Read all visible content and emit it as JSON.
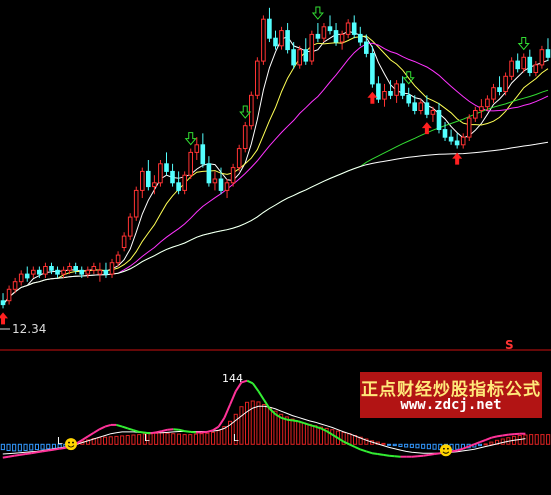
{
  "watermark": {
    "title": "正点财经炒股指标公式",
    "url": "www.zdcj.net"
  },
  "colors": {
    "background": "#000000",
    "up_candle": "#ff3333",
    "down_candle": "#54ffff",
    "ma5": "#ffffff",
    "ma10": "#ffff55",
    "ma20": "#ff33ff",
    "ma60": "#33dd33",
    "ma120": "#ffffff",
    "buy_arrow": "#ff2020",
    "sell_arrow": "#33dd33",
    "separator": "#cc1111",
    "osc_up_line": "#ff3399",
    "osc_down_line": "#33ee33",
    "osc_signal": "#ffffff",
    "osc_bar_up": "#dd2222",
    "osc_bar_down": "#3399ff",
    "smiley": "#ffd400"
  },
  "chart_data": [
    {
      "type": "candlestick",
      "annotations": {
        "low_price_label": "12.34",
        "marker_s": "S"
      },
      "candles": [
        [
          11.9,
          12.1,
          11.7,
          11.8
        ],
        [
          11.9,
          12.3,
          11.8,
          12.2
        ],
        [
          12.2,
          12.5,
          12.1,
          12.4
        ],
        [
          12.4,
          12.7,
          12.3,
          12.6
        ],
        [
          12.6,
          12.8,
          12.4,
          12.5
        ],
        [
          12.6,
          12.8,
          12.5,
          12.7
        ],
        [
          12.7,
          12.8,
          12.5,
          12.6
        ],
        [
          12.6,
          12.9,
          12.5,
          12.8
        ],
        [
          12.8,
          12.9,
          12.6,
          12.7
        ],
        [
          12.7,
          12.8,
          12.5,
          12.6
        ],
        [
          12.6,
          12.8,
          12.5,
          12.7
        ],
        [
          12.7,
          12.9,
          12.6,
          12.8
        ],
        [
          12.8,
          12.9,
          12.6,
          12.7
        ],
        [
          12.7,
          12.8,
          12.5,
          12.6
        ],
        [
          12.6,
          12.8,
          12.5,
          12.7
        ],
        [
          12.7,
          12.9,
          12.6,
          12.8
        ],
        [
          12.6,
          12.9,
          12.4,
          12.7
        ],
        [
          12.7,
          12.9,
          12.5,
          12.6
        ],
        [
          12.6,
          13.0,
          12.5,
          12.9
        ],
        [
          12.9,
          13.2,
          12.8,
          13.1
        ],
        [
          13.3,
          13.7,
          13.2,
          13.6
        ],
        [
          13.6,
          14.2,
          13.5,
          14.1
        ],
        [
          14.1,
          14.9,
          14.0,
          14.8
        ],
        [
          14.8,
          15.4,
          14.6,
          15.3
        ],
        [
          15.3,
          15.6,
          14.8,
          14.9
        ],
        [
          14.9,
          15.2,
          14.7,
          15.0
        ],
        [
          15.0,
          15.6,
          14.9,
          15.5
        ],
        [
          15.5,
          15.8,
          15.2,
          15.3
        ],
        [
          15.3,
          15.5,
          14.9,
          15.0
        ],
        [
          15.0,
          15.3,
          14.7,
          14.8
        ],
        [
          14.8,
          15.3,
          14.7,
          15.2
        ],
        [
          15.2,
          15.9,
          15.1,
          15.8
        ],
        [
          15.8,
          16.2,
          15.6,
          16.0
        ],
        [
          16.0,
          16.3,
          15.4,
          15.5
        ],
        [
          15.5,
          15.7,
          14.9,
          15.0
        ],
        [
          15.0,
          15.3,
          14.8,
          15.1
        ],
        [
          15.1,
          15.4,
          14.7,
          14.8
        ],
        [
          14.8,
          15.1,
          14.6,
          15.0
        ],
        [
          15.0,
          15.5,
          14.9,
          15.4
        ],
        [
          15.4,
          16.0,
          15.3,
          15.9
        ],
        [
          15.9,
          16.6,
          15.8,
          16.5
        ],
        [
          16.5,
          17.4,
          16.4,
          17.3
        ],
        [
          17.3,
          18.3,
          17.2,
          18.2
        ],
        [
          18.2,
          19.4,
          18.1,
          19.3
        ],
        [
          19.3,
          19.6,
          18.7,
          18.8
        ],
        [
          18.8,
          19.0,
          18.5,
          18.6
        ],
        [
          18.6,
          19.1,
          18.5,
          19.0
        ],
        [
          19.0,
          19.2,
          18.4,
          18.5
        ],
        [
          18.5,
          18.7,
          18.0,
          18.1
        ],
        [
          18.1,
          18.6,
          18.0,
          18.5
        ],
        [
          18.5,
          18.8,
          18.1,
          18.2
        ],
        [
          18.2,
          19.0,
          18.1,
          18.9
        ],
        [
          18.9,
          19.2,
          18.7,
          18.8
        ],
        [
          18.8,
          19.2,
          18.7,
          19.1
        ],
        [
          19.1,
          19.4,
          18.9,
          19.0
        ],
        [
          19.0,
          19.2,
          18.6,
          18.7
        ],
        [
          18.7,
          19.0,
          18.5,
          18.9
        ],
        [
          18.9,
          19.3,
          18.8,
          19.2
        ],
        [
          19.2,
          19.4,
          18.8,
          18.9
        ],
        [
          18.9,
          19.1,
          18.6,
          18.7
        ],
        [
          18.7,
          18.9,
          18.3,
          18.4
        ],
        [
          18.4,
          18.6,
          17.5,
          17.6
        ],
        [
          17.6,
          17.8,
          17.1,
          17.2
        ],
        [
          17.2,
          17.6,
          17.0,
          17.4
        ],
        [
          17.4,
          17.7,
          17.2,
          17.3
        ],
        [
          17.3,
          17.7,
          17.1,
          17.6
        ],
        [
          17.6,
          17.8,
          17.2,
          17.3
        ],
        [
          17.3,
          17.5,
          17.0,
          17.1
        ],
        [
          17.1,
          17.3,
          16.8,
          16.9
        ],
        [
          16.9,
          17.2,
          16.8,
          17.1
        ],
        [
          17.1,
          17.3,
          16.7,
          16.8
        ],
        [
          16.8,
          17.0,
          16.6,
          16.9
        ],
        [
          16.9,
          17.1,
          16.3,
          16.4
        ],
        [
          16.4,
          16.6,
          16.1,
          16.2
        ],
        [
          16.2,
          16.4,
          16.0,
          16.1
        ],
        [
          16.1,
          16.3,
          15.9,
          16.0
        ],
        [
          16.0,
          16.3,
          15.9,
          16.2
        ],
        [
          16.2,
          16.8,
          16.1,
          16.7
        ],
        [
          16.7,
          17.0,
          16.6,
          16.9
        ],
        [
          16.9,
          17.2,
          16.7,
          17.0
        ],
        [
          17.0,
          17.3,
          16.9,
          17.2
        ],
        [
          17.2,
          17.6,
          17.1,
          17.5
        ],
        [
          17.5,
          17.8,
          17.3,
          17.4
        ],
        [
          17.4,
          17.9,
          17.3,
          17.8
        ],
        [
          17.8,
          18.3,
          17.7,
          18.2
        ],
        [
          18.2,
          18.4,
          17.9,
          18.0
        ],
        [
          18.0,
          18.4,
          17.9,
          18.3
        ],
        [
          18.3,
          18.5,
          17.8,
          17.9
        ],
        [
          17.9,
          18.2,
          17.8,
          18.1
        ],
        [
          18.1,
          18.6,
          18.0,
          18.5
        ],
        [
          18.5,
          18.8,
          18.2,
          18.3
        ]
      ],
      "buy_signals": [
        0,
        61,
        70,
        75
      ],
      "sell_signals": [
        31,
        40,
        52,
        67,
        86
      ]
    },
    {
      "type": "bar",
      "series_signal": "oscillator",
      "labels": {
        "peak_value": "144",
        "marker_1": "L",
        "marker_2": "L",
        "marker_3": "L"
      },
      "bars": [
        -12,
        -14,
        -15,
        -15,
        -14,
        -13,
        -12,
        -11,
        -10,
        -9,
        -8,
        -6,
        -2,
        3,
        7,
        10,
        13,
        15,
        16,
        17,
        18,
        19,
        20,
        21,
        22,
        23,
        24,
        25,
        26,
        25,
        24,
        23,
        22,
        22,
        23,
        24,
        25,
        27,
        31,
        40,
        52,
        68,
        85,
        95,
        98,
        96,
        90,
        83,
        75,
        68,
        62,
        57,
        52,
        48,
        45,
        42,
        39,
        36,
        33,
        30,
        27,
        24,
        20,
        16,
        12,
        8,
        5,
        2,
        -1,
        -3,
        -5,
        -6,
        -7,
        -8,
        -9,
        -10,
        -11,
        -12,
        -12,
        -12,
        -11,
        -10,
        -8,
        -6,
        -3,
        1,
        5,
        9,
        12,
        15,
        18,
        20,
        21,
        22,
        22,
        22,
        22
      ],
      "line": [
        -30,
        -28,
        -26,
        -24,
        -22,
        -20,
        -18,
        -16,
        -14,
        -12,
        -10,
        -8,
        -4,
        2,
        10,
        18,
        26,
        34,
        40,
        44,
        44,
        40,
        36,
        32,
        28,
        26,
        25,
        27,
        30,
        33,
        34,
        33,
        30,
        28,
        27,
        27,
        28,
        32,
        40,
        60,
        90,
        120,
        140,
        144,
        138,
        120,
        100,
        80,
        68,
        60,
        56,
        54,
        52,
        48,
        44,
        40,
        36,
        30,
        22,
        14,
        6,
        0,
        -6,
        -12,
        -16,
        -20,
        -22,
        -24,
        -26,
        -27,
        -28,
        -28,
        -28,
        -27,
        -26,
        -24,
        -22,
        -20,
        -18,
        -16,
        -14,
        -10,
        -5,
        0,
        5,
        10,
        15,
        18,
        20,
        22,
        23,
        24,
        24
      ],
      "signal": [
        -22,
        -21,
        -20,
        -19,
        -18,
        -17,
        -16,
        -14,
        -12,
        -10,
        -8,
        -6,
        -4,
        0,
        4,
        8,
        12,
        16,
        20,
        24,
        26,
        28,
        28,
        28,
        27,
        27,
        26,
        26,
        26,
        27,
        28,
        29,
        29,
        29,
        29,
        29,
        29,
        30,
        32,
        36,
        44,
        54,
        64,
        74,
        82,
        86,
        86,
        84,
        80,
        75,
        70,
        65,
        61,
        57,
        53,
        50,
        46,
        42,
        38,
        33,
        28,
        24,
        19,
        14,
        9,
        5,
        1,
        -3,
        -7,
        -10,
        -13,
        -16,
        -18,
        -19,
        -20,
        -20,
        -20,
        -20,
        -19,
        -18,
        -17,
        -15,
        -13,
        -11,
        -8,
        -5,
        -2,
        1,
        4,
        7,
        9,
        11,
        13
      ]
    }
  ]
}
